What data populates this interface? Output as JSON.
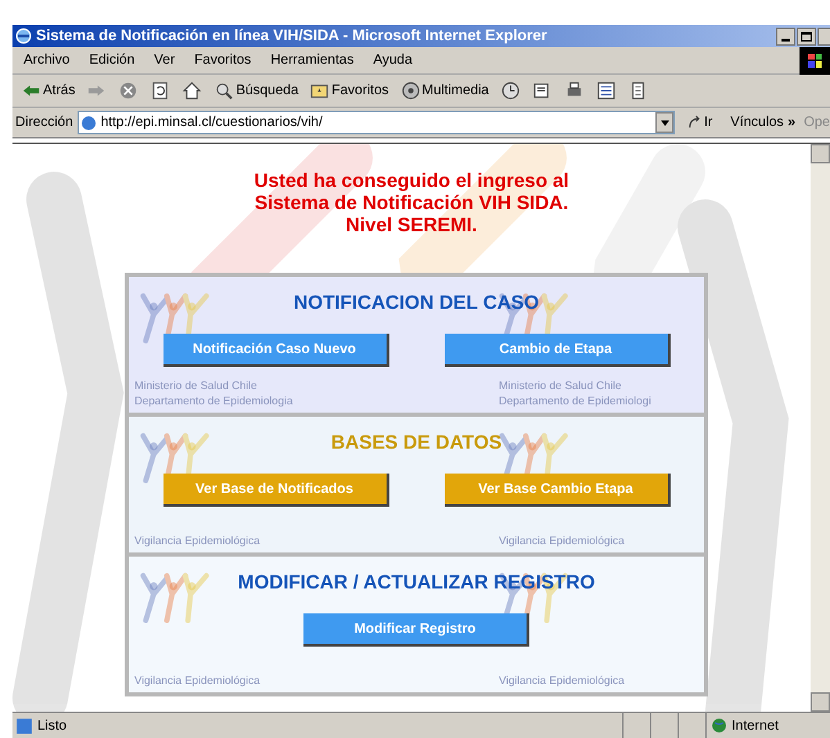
{
  "window": {
    "title": "Sistema de Notificación en línea VIH/SIDA - Microsoft Internet Explorer"
  },
  "menu": [
    "Archivo",
    "Edición",
    "Ver",
    "Favoritos",
    "Herramientas",
    "Ayuda"
  ],
  "toolbar": [
    {
      "kind": "back",
      "label": "Atrás"
    },
    {
      "kind": "forward"
    },
    {
      "kind": "stop"
    },
    {
      "kind": "refresh"
    },
    {
      "kind": "home"
    },
    {
      "kind": "search",
      "label": "Búsqueda"
    },
    {
      "kind": "favorites",
      "label": "Favoritos"
    },
    {
      "kind": "media",
      "label": "Multimedia"
    },
    {
      "kind": "history"
    },
    {
      "kind": "mail"
    },
    {
      "kind": "print"
    },
    {
      "kind": "edit"
    },
    {
      "kind": "discuss"
    }
  ],
  "address": {
    "label": "Dirección",
    "value": "http://epi.minsal.cl/cuestionarios/vih/",
    "go": "Ir",
    "links": "Vínculos",
    "links_more": "»",
    "link_item": "Ope"
  },
  "message": [
    "Usted ha conseguido el ingreso al",
    "Sistema de Notificación VIH SIDA.",
    "Nivel SEREMI."
  ],
  "panels": [
    {
      "kind": "blue",
      "title": "NOTIFICACION DEL CASO",
      "buttons": [
        "Notificación Caso Nuevo",
        "Cambio de Etapa"
      ],
      "captions_left": [
        "Ministerio de Salud Chile",
        "Departamento de Epidemiologia"
      ],
      "captions_right": [
        "Ministerio de Salud Chile",
        "Departamento de Epidemiologi"
      ]
    },
    {
      "kind": "gold",
      "title": "BASES DE DATOS",
      "buttons": [
        "Ver Base de Notificados",
        "Ver Base Cambio Etapa"
      ],
      "captions_left": [
        "Vigilancia Epidemiológica"
      ],
      "captions_right": [
        "Vigilancia Epidemiológica"
      ]
    },
    {
      "kind": "white",
      "title": "MODIFICAR / ACTUALIZAR REGISTRO",
      "buttons": [
        "Modificar Registro"
      ],
      "captions_left": [
        "Vigilancia Epidemiológica"
      ],
      "captions_right": [
        "Vigilancia Epidemiológica"
      ]
    }
  ],
  "status_bar": {
    "text": "Listo",
    "zone": "Internet"
  }
}
